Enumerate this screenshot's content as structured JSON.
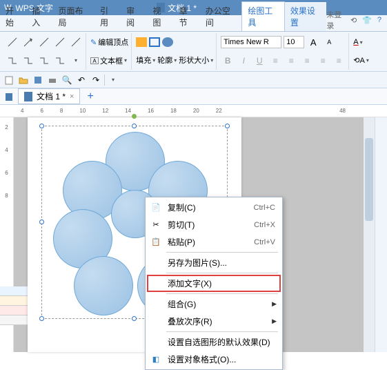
{
  "app": {
    "name": "WPS 文字",
    "doctitle": "文档 1 *"
  },
  "menus": {
    "items": [
      "开始",
      "插入",
      "页面布局",
      "引用",
      "审阅",
      "视图",
      "章节",
      "办公空间",
      "绘图工具",
      "效果设置"
    ],
    "active_index": 8,
    "login": "未登录"
  },
  "ribbon": {
    "editgroup": {
      "editvertex": "编辑顶点",
      "textbox": "文本框"
    },
    "fill": "填充",
    "outline": "轮廓",
    "shapesize": "形状大小",
    "font_name": "Times New R",
    "font_size": "10"
  },
  "doctab": {
    "name": "文档 1 *"
  },
  "ruler_top": [
    "4",
    "6",
    "8",
    "10",
    "12",
    "14",
    "16",
    "18",
    "20",
    "22",
    "48"
  ],
  "ruler_left": [
    "2",
    "4",
    "6",
    "8"
  ],
  "context_menu": {
    "copy": "复制(C)",
    "copy_key": "Ctrl+C",
    "cut": "剪切(T)",
    "cut_key": "Ctrl+X",
    "paste": "粘贴(P)",
    "paste_key": "Ctrl+V",
    "save_as_pic": "另存为图片(S)...",
    "add_text": "添加文字(X)",
    "group": "组合(G)",
    "order": "叠放次序(R)",
    "default_effect": "设置自选图形的默认效果(D)",
    "format_object": "设置对象格式(O)..."
  }
}
